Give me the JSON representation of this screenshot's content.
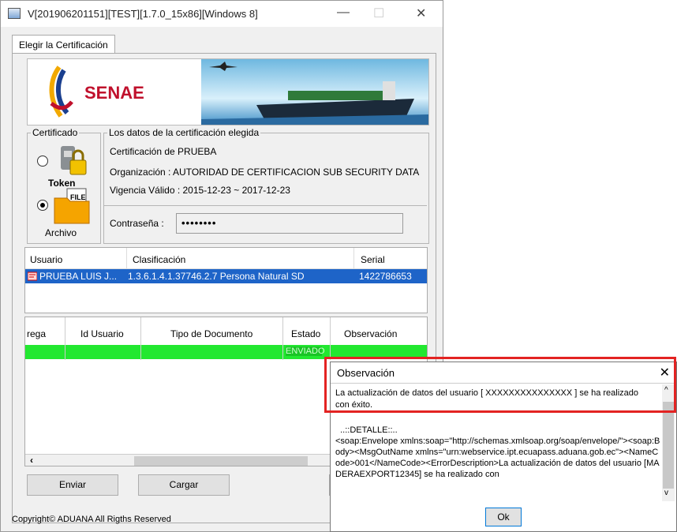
{
  "window": {
    "title": "V[201906201151][TEST][1.7.0_15x86][Windows 8]",
    "tab": "Elegir la Certificación",
    "banner_brand": "SENAE"
  },
  "certificado": {
    "legend": "Certificado",
    "token_label": "Token",
    "archivo_label": "Archivo",
    "selected": "Archivo"
  },
  "datos": {
    "legend": "Los datos de la certificación elegida",
    "name": "Certificación de PRUEBA",
    "organizacion": "Organización : AUTORIDAD DE CERTIFICACION SUB SECURITY DATA",
    "vigencia": "Vigencia Válido : 2015-12-23 ~ 2017-12-23",
    "password_label": "Contraseña :",
    "password_value": "••••••••"
  },
  "cert_table": {
    "headers": [
      "Usuario",
      "Clasificación",
      "Serial"
    ],
    "row": [
      "PRUEBA LUIS J...",
      "1.3.6.1.4.1.37746.2.7 Persona Natural SD",
      "1422786653"
    ]
  },
  "doc_table": {
    "headers": [
      "rega",
      "Id Usuario",
      "Tipo de Documento",
      "Estado",
      "Observación"
    ],
    "estado": "ENVIADO"
  },
  "buttons": {
    "enviar": "Enviar",
    "cargar": "Cargar"
  },
  "footer": "Copyright© ADUANA All Rigths Reserved",
  "dialog": {
    "title": "Observación",
    "message": "La actualización de datos del usuario [  XXXXXXXXXXXXXXX  ] se ha realizado con éxito.",
    "detail": "  ..::DETALLE::..\n<soap:Envelope xmlns:soap=\"http://schemas.xmlsoap.org/soap/envelope/\"><soap:Body><MsgOutName xmlns=\"urn:webservice.ipt.ecuapass.aduana.gob.ec\"><NameCode>001</NameCode><ErrorDescription>La actualización de datos del usuario [MADERAEXPORT12345] se ha realizado con",
    "ok": "Ok"
  }
}
